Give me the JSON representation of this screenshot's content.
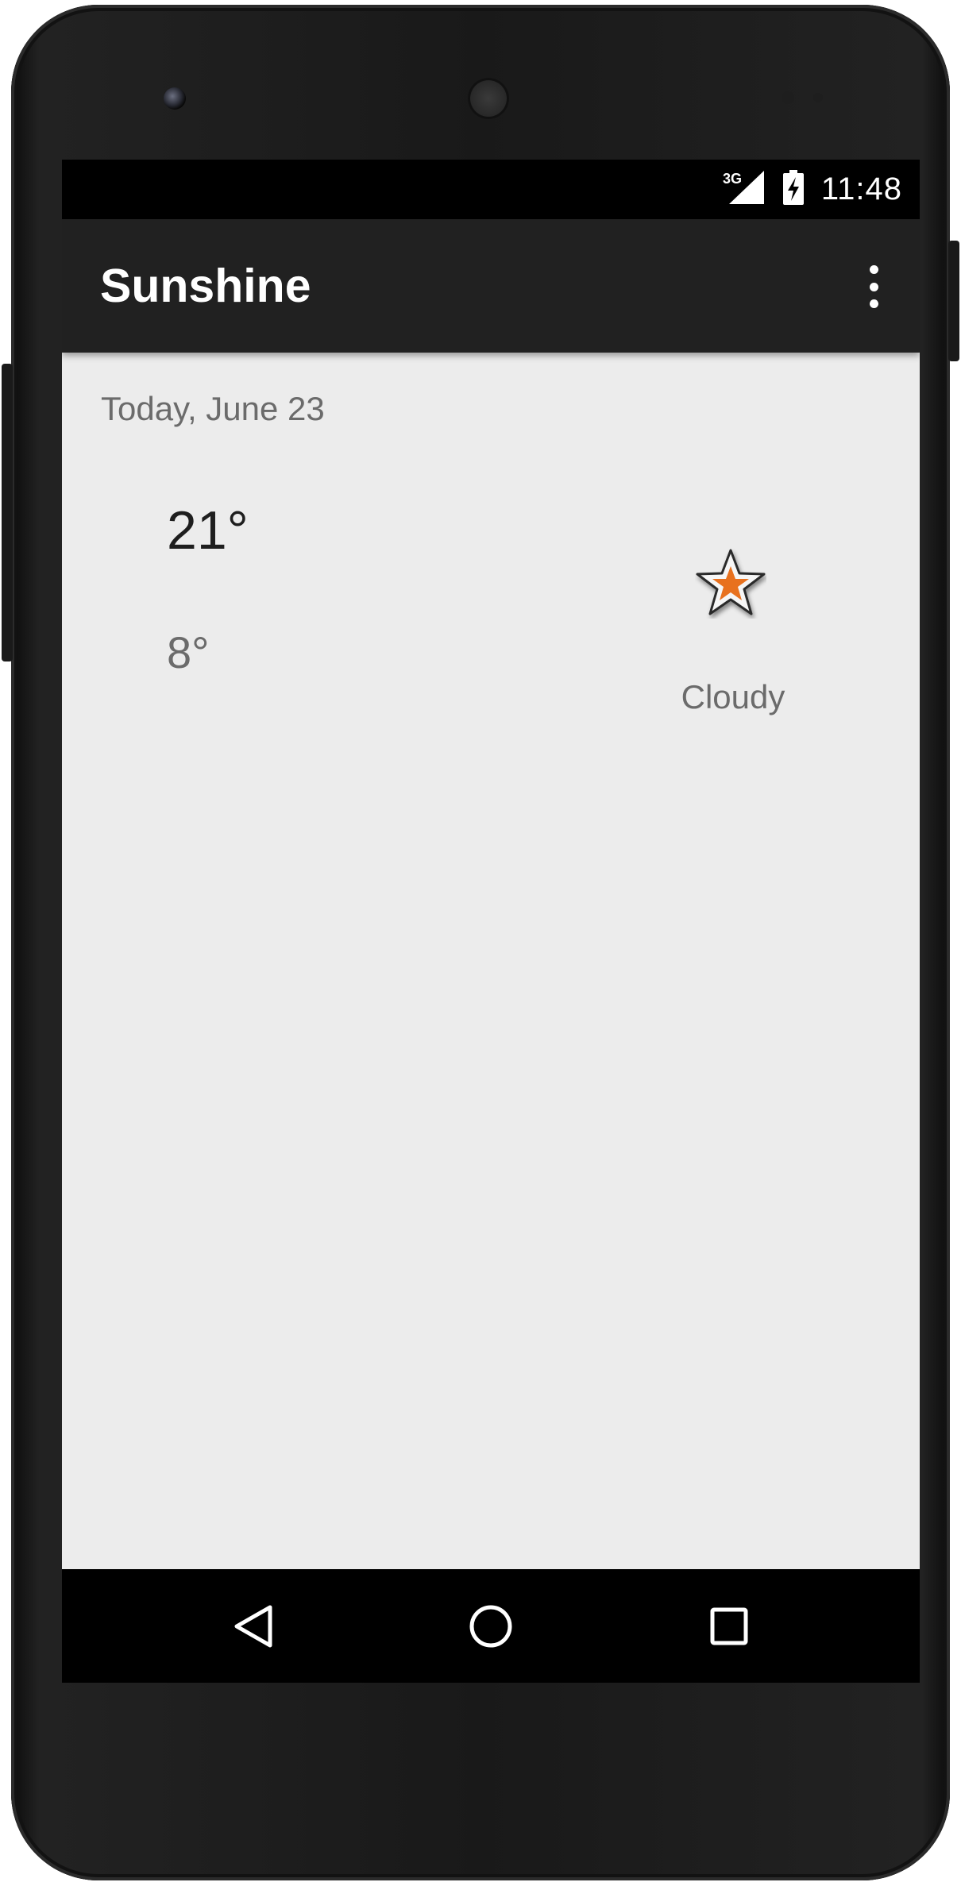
{
  "status_bar": {
    "network": "3G",
    "time": "11:48"
  },
  "app_bar": {
    "title": "Sunshine",
    "overflow_icon": "more-vert-icon"
  },
  "detail": {
    "date": "Today, June 23",
    "high": "21°",
    "low": "8°",
    "condition": "Cloudy",
    "condition_icon": "star-icon",
    "icon_fill_color": "#e8711e"
  },
  "nav_bar": {
    "back_icon": "back-triangle-icon",
    "home_icon": "home-circle-icon",
    "recents_icon": "recents-square-icon"
  },
  "colors": {
    "app_bar_bg": "#212121",
    "screen_bg": "#ececec",
    "primary_text": "#1e1e1e",
    "secondary_text": "#6b6b6b"
  }
}
